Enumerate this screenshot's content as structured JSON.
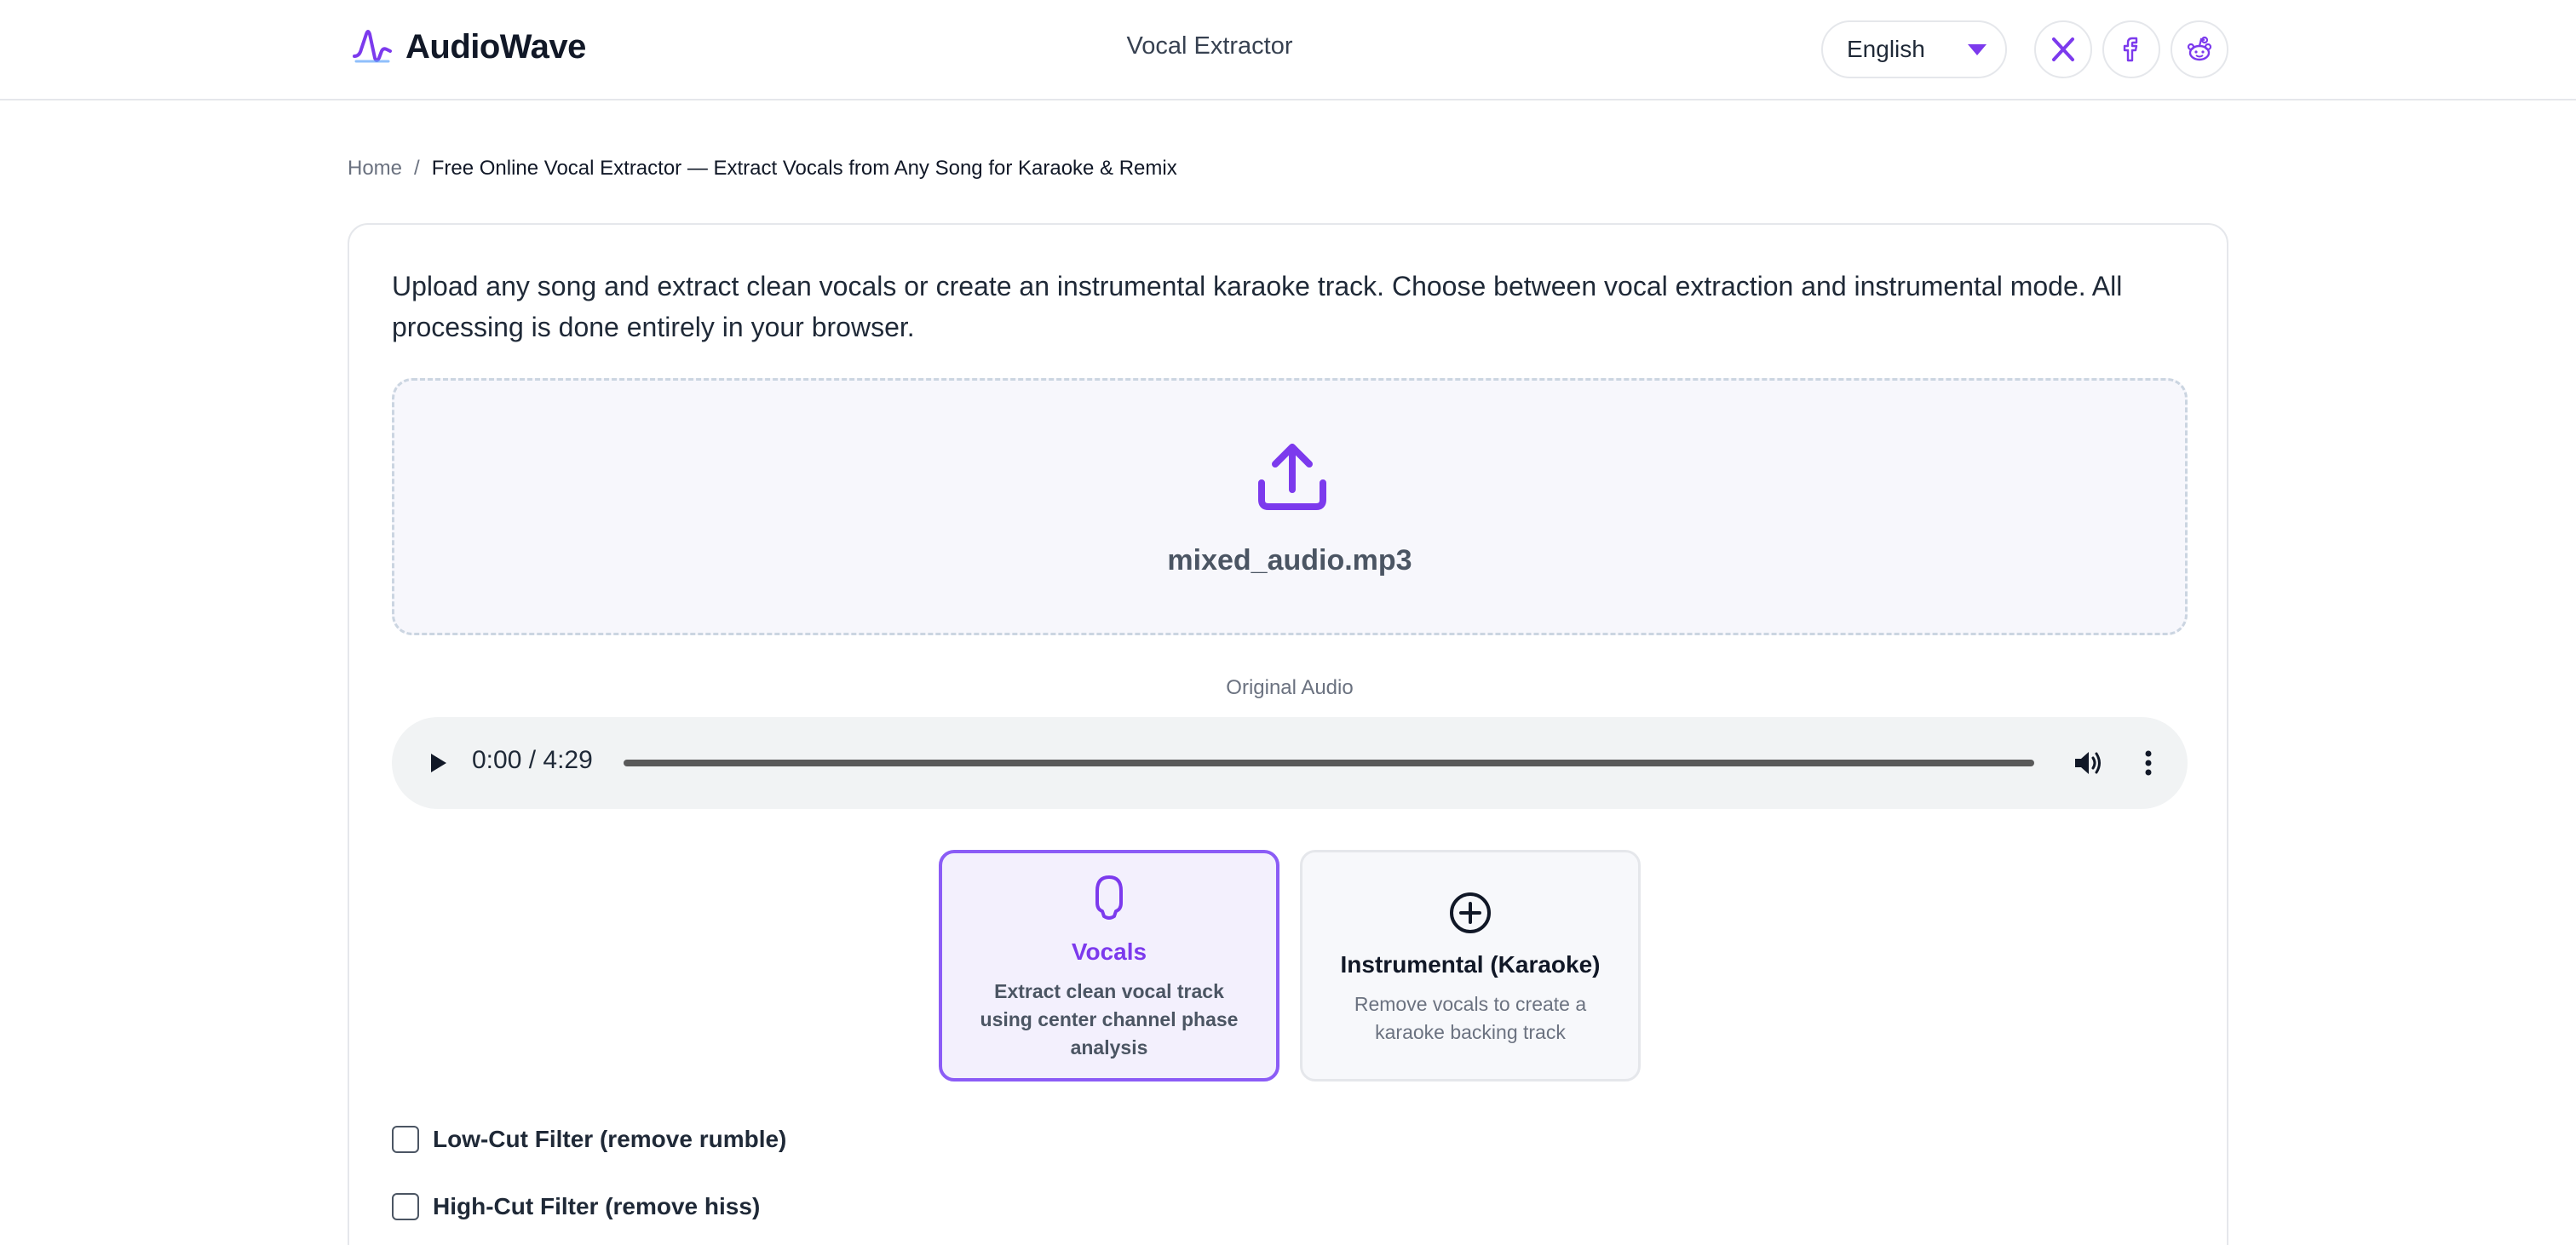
{
  "header": {
    "brand": "AudioWave",
    "title": "Vocal Extractor",
    "language": "English"
  },
  "breadcrumb": {
    "home": "Home",
    "separator": "/",
    "current": "Free Online Vocal Extractor — Extract Vocals from Any Song for Karaoke & Remix"
  },
  "main": {
    "intro": "Upload any song and extract clean vocals or create an instrumental karaoke track. Choose between vocal extraction and instrumental mode. All processing is done entirely in your browser.",
    "upload": {
      "file_name": "mixed_audio.mp3"
    },
    "audio": {
      "label": "Original Audio",
      "time": "0:00 / 4:29",
      "progress": 0
    },
    "modes": [
      {
        "title": "Vocals",
        "description": "Extract clean vocal track using center channel phase analysis",
        "selected": true
      },
      {
        "title": "Instrumental (Karaoke)",
        "description": "Remove vocals to create a karaoke backing track",
        "selected": false
      }
    ],
    "options": [
      {
        "label": "Low-Cut Filter (remove rumble)",
        "checked": false
      },
      {
        "label": "High-Cut Filter (remove hiss)",
        "checked": false
      }
    ]
  },
  "colors": {
    "accent": "#7c3aed",
    "accent_light": "#f3f0fd",
    "border": "#e5e7eb",
    "player_bg": "#f1f3f4"
  }
}
